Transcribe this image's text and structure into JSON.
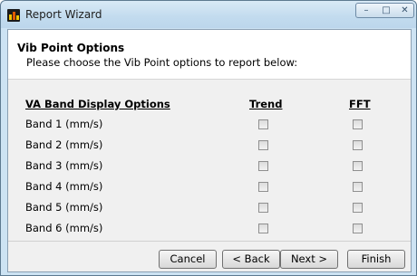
{
  "window": {
    "title": "Report Wizard"
  },
  "controls": {
    "minimize": "–",
    "maximize": "□",
    "close": "✕"
  },
  "header": {
    "title": "Vib Point Options",
    "subtitle": "Please choose the Vib Point options to report below:"
  },
  "columns": {
    "label": "VA Band Display Options",
    "trend": "Trend",
    "fft": "FFT"
  },
  "rows": [
    {
      "label": "Band 1 (mm/s)",
      "trend": false,
      "fft": false
    },
    {
      "label": "Band 2 (mm/s)",
      "trend": false,
      "fft": false
    },
    {
      "label": "Band 3 (mm/s)",
      "trend": false,
      "fft": false
    },
    {
      "label": "Band 4 (mm/s)",
      "trend": false,
      "fft": false
    },
    {
      "label": "Band 5 (mm/s)",
      "trend": false,
      "fft": false
    },
    {
      "label": "Band 6 (mm/s)",
      "trend": false,
      "fft": false
    }
  ],
  "buttons": {
    "cancel": "Cancel",
    "back": "< Back",
    "next": "Next >",
    "finish": "Finish"
  }
}
